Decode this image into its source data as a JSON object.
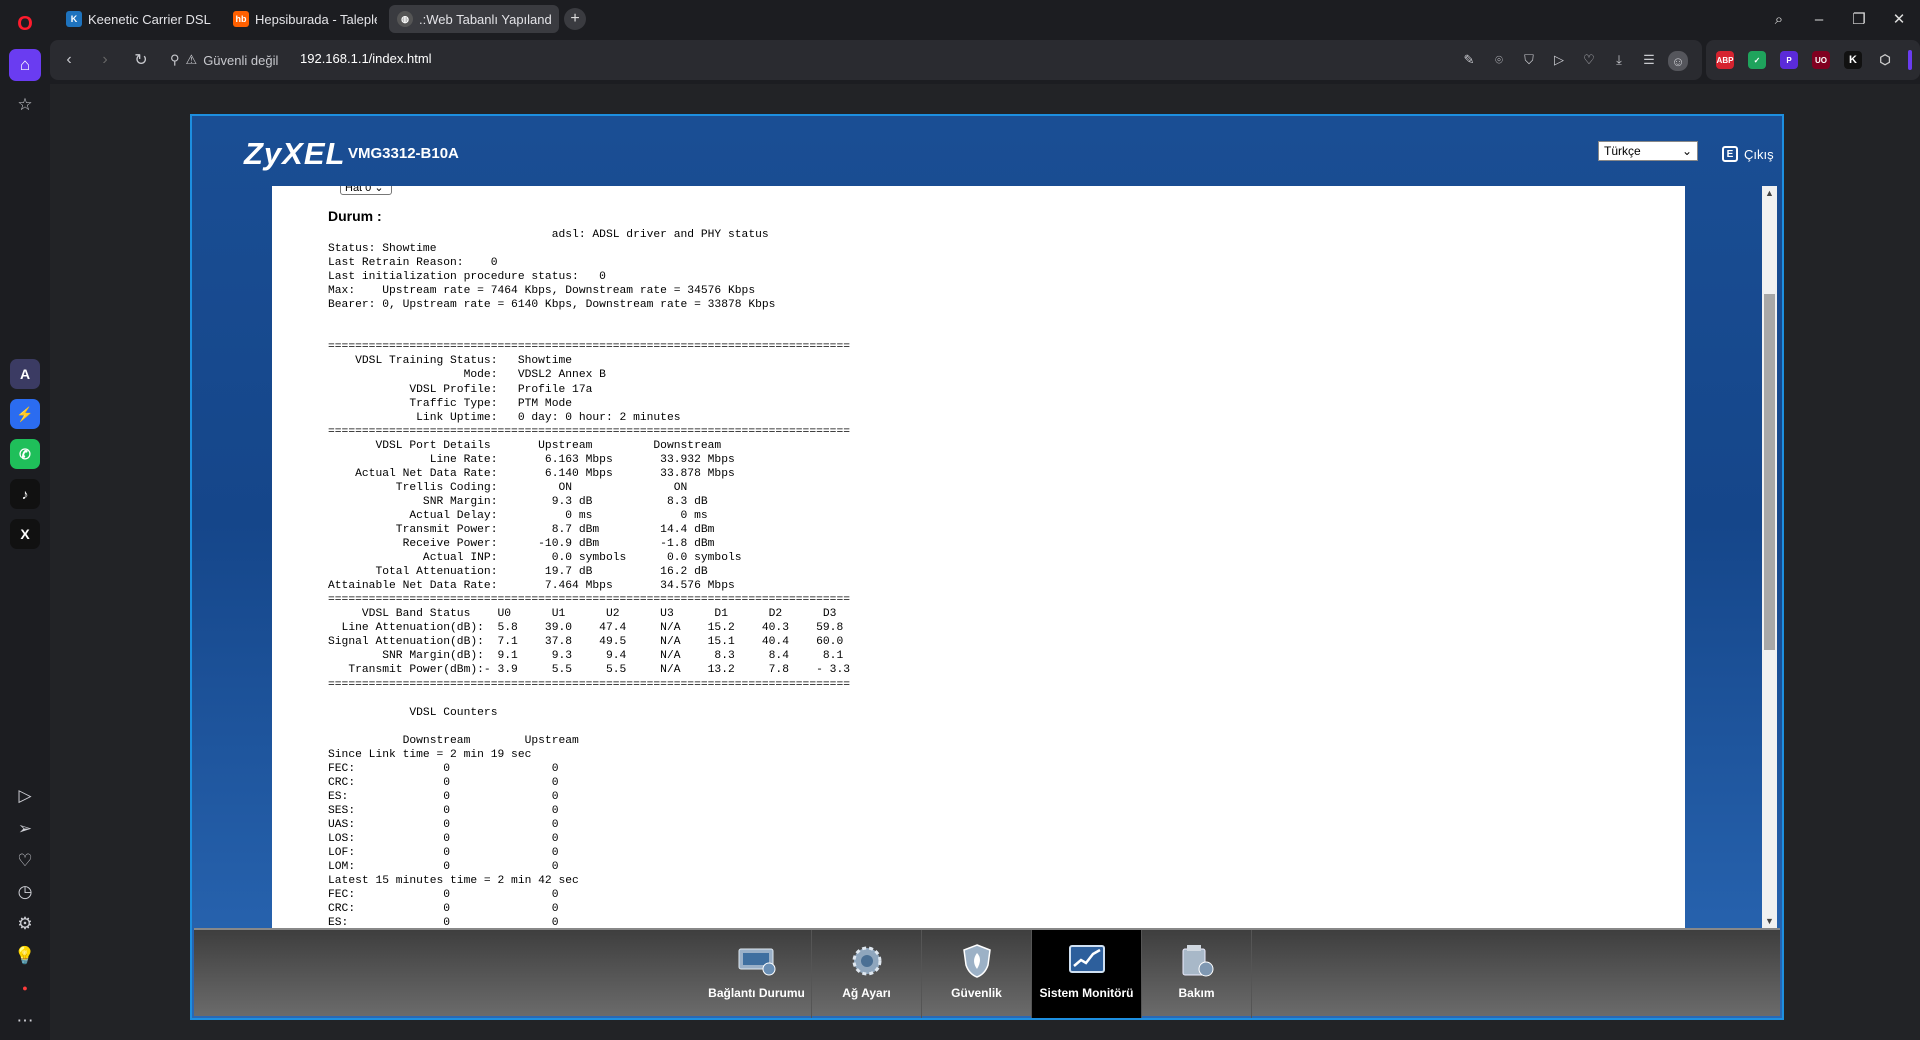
{
  "tabs": [
    {
      "title": "Keenetic Carrier DSL – Gir",
      "favicon": "K",
      "color": "#1e73be"
    },
    {
      "title": "Hepsiburada - Taleplerim",
      "favicon": "hb",
      "color": "#ff6000"
    },
    {
      "title": ".:Web Tabanlı Yapılandırıc",
      "favicon": "globe-icon",
      "color": "#444"
    }
  ],
  "address": {
    "security": "Güvenli değil",
    "url": "192.168.1.1/index.html"
  },
  "extensions": [
    "ABP",
    "UO",
    "K"
  ],
  "router": {
    "brand": "ZyXEL",
    "model": "VMG3312-B10A",
    "language": "Türkçe",
    "logout": "Çıkış",
    "line_select": "Hat 0",
    "status_heading": "Durum :",
    "status_text": "                                 adsl: ADSL driver and PHY status\nStatus: Showtime\nLast Retrain Reason:    0\nLast initialization procedure status:   0\nMax:    Upstream rate = 7464 Kbps, Downstream rate = 34576 Kbps\nBearer: 0, Upstream rate = 6140 Kbps, Downstream rate = 33878 Kbps\n\n\n=============================================================================\n    VDSL Training Status:   Showtime\n                    Mode:   VDSL2 Annex B\n            VDSL Profile:   Profile 17a\n            Traffic Type:   PTM Mode\n             Link Uptime:   0 day: 0 hour: 2 minutes\n=============================================================================\n       VDSL Port Details       Upstream         Downstream\n               Line Rate:       6.163 Mbps       33.932 Mbps\n    Actual Net Data Rate:       6.140 Mbps       33.878 Mbps\n          Trellis Coding:         ON               ON\n              SNR Margin:        9.3 dB           8.3 dB\n            Actual Delay:          0 ms             0 ms\n          Transmit Power:        8.7 dBm         14.4 dBm\n           Receive Power:      -10.9 dBm         -1.8 dBm\n              Actual INP:        0.0 symbols      0.0 symbols\n       Total Attenuation:       19.7 dB          16.2 dB\nAttainable Net Data Rate:       7.464 Mbps       34.576 Mbps\n=============================================================================\n     VDSL Band Status    U0      U1      U2      U3      D1      D2      D3\n  Line Attenuation(dB):  5.8    39.0    47.4     N/A    15.2    40.3    59.8\nSignal Attenuation(dB):  7.1    37.8    49.5     N/A    15.1    40.4    60.0\n        SNR Margin(dB):  9.1     9.3     9.4     N/A     8.3     8.4     8.1\n   Transmit Power(dBm):- 3.9     5.5     5.5     N/A    13.2     7.8    - 3.3\n=============================================================================\n\n            VDSL Counters\n\n           Downstream        Upstream\nSince Link time = 2 min 19 sec\nFEC:             0               0\nCRC:             0               0\nES:              0               0\nSES:             0               0\nUAS:             0               0\nLOS:             0               0\nLOF:             0               0\nLOM:             0               0\nLatest 15 minutes time = 2 min 42 sec\nFEC:             0               0\nCRC:             0               0\nES:              0               0",
    "menu": [
      {
        "label": "Bağlantı Durumu",
        "icon": "connection-status-icon"
      },
      {
        "label": "Ağ Ayarı",
        "icon": "network-gear-icon"
      },
      {
        "label": "Güvenlik",
        "icon": "security-shield-icon"
      },
      {
        "label": "Sistem Monitörü",
        "icon": "system-monitor-icon",
        "active": true
      },
      {
        "label": "Bakım",
        "icon": "maintenance-icon"
      }
    ]
  }
}
